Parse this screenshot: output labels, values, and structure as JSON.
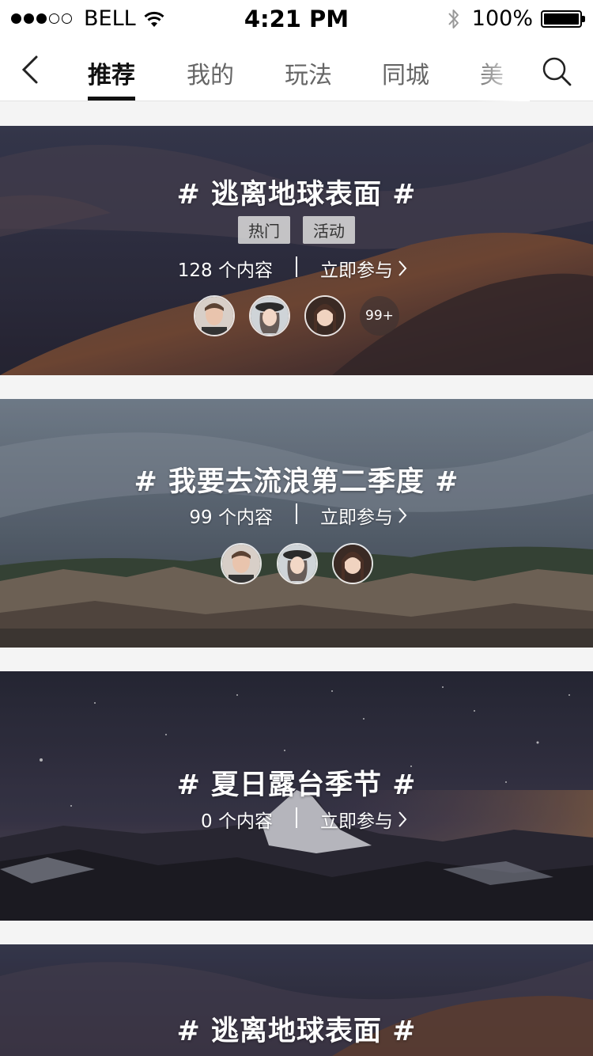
{
  "status_bar": {
    "carrier": "BELL",
    "time": "4:21 PM",
    "battery_text": "100%",
    "battery_level": 1.0,
    "signal_bars_filled": 3,
    "signal_bars_total": 5,
    "icons": [
      "wifi-icon",
      "bluetooth-icon",
      "battery-icon"
    ]
  },
  "nav": {
    "back_icon": "chevron-left-icon",
    "search_icon": "search-icon",
    "tabs": [
      {
        "label": "推荐",
        "active": true
      },
      {
        "label": "我的",
        "active": false
      },
      {
        "label": "玩法",
        "active": false
      },
      {
        "label": "同城",
        "active": false
      },
      {
        "label": "美",
        "active": false
      }
    ]
  },
  "topics": [
    {
      "title": "# 逃离地球表面 #",
      "tags": [
        "热门",
        "活动"
      ],
      "count_text": "128 个内容",
      "join_text": "立即参与",
      "more_badge": "99+"
    },
    {
      "title": "# 我要去流浪第二季度 #",
      "count_text": "99 个内容",
      "join_text": "立即参与"
    },
    {
      "title": "# 夏日露台季节 #",
      "count_text": "0 个内容",
      "join_text": "立即参与"
    },
    {
      "title": "# 逃离地球表面 #"
    }
  ],
  "colors": {
    "active_tab": "#111111",
    "inactive_tab": "#666666",
    "page_bg": "#f4f4f4"
  }
}
